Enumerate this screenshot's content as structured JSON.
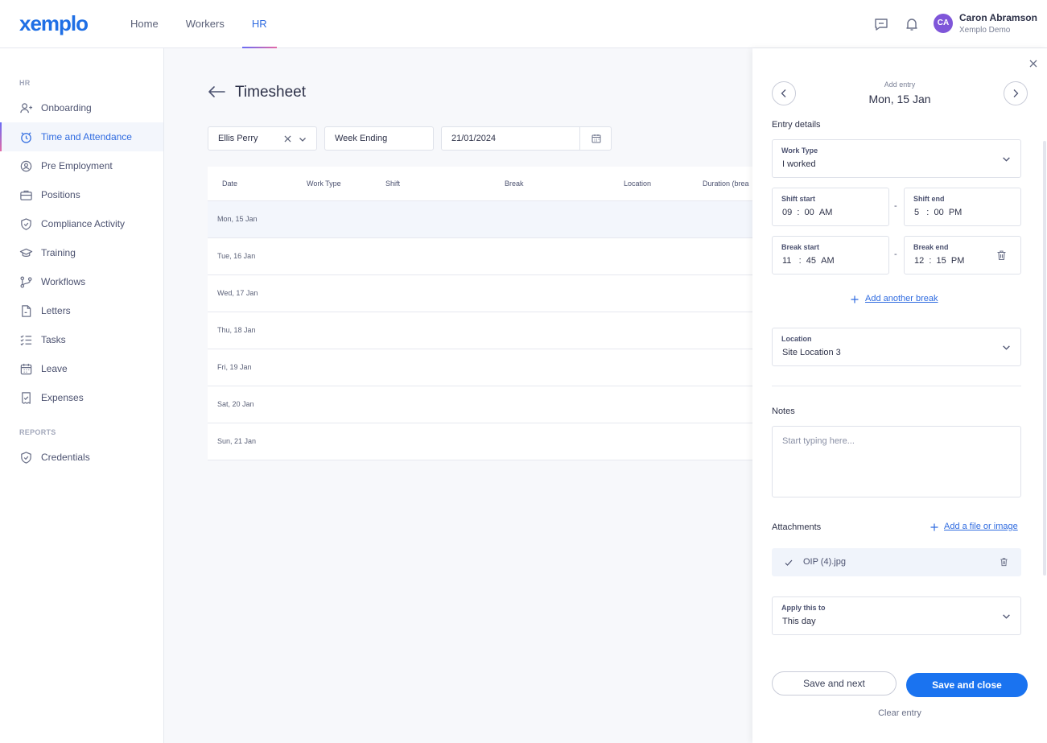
{
  "header": {
    "logo": "xemplo",
    "nav": [
      "Home",
      "Workers",
      "HR"
    ],
    "active_nav": "HR",
    "user": {
      "initials": "CA",
      "name": "Caron Abramson",
      "org": "Xemplo Demo"
    },
    "icons": [
      "chat-icon",
      "bell-icon"
    ]
  },
  "sidebar": {
    "section_hr": "HR",
    "items": [
      {
        "label": "Onboarding",
        "icon": "user-plus-icon"
      },
      {
        "label": "Time and Attendance",
        "icon": "clock-icon"
      },
      {
        "label": "Pre Employment",
        "icon": "user-check-icon"
      },
      {
        "label": "Positions",
        "icon": "briefcase-icon"
      },
      {
        "label": "Compliance Activity",
        "icon": "shield-check-icon"
      },
      {
        "label": "Training",
        "icon": "graduation-cap-icon"
      },
      {
        "label": "Workflows",
        "icon": "workflow-icon"
      },
      {
        "label": "Letters",
        "icon": "document-icon"
      },
      {
        "label": "Tasks",
        "icon": "checklist-icon"
      },
      {
        "label": "Leave",
        "icon": "calendar-icon"
      },
      {
        "label": "Expenses",
        "icon": "receipt-icon"
      }
    ],
    "section_reports": "REPORTS",
    "report_items": [
      {
        "label": "Credentials",
        "icon": "badge-check-icon"
      }
    ]
  },
  "main": {
    "title": "Timesheet",
    "filters": {
      "worker": "Ellis Perry",
      "period_type": "Week Ending",
      "date": "21/01/2024"
    },
    "columns": [
      "Date",
      "Work Type",
      "Shift",
      "Break",
      "Location",
      "Duration (brea"
    ],
    "rows": [
      "Mon, 15 Jan",
      "Tue, 16 Jan",
      "Wed, 17 Jan",
      "Thu, 18 Jan",
      "Fri, 19 Jan",
      "Sat, 20 Jan",
      "Sun, 21 Jan"
    ]
  },
  "drawer": {
    "subtitle": "Add entry",
    "date": "Mon, 15 Jan",
    "entry_details_label": "Entry details",
    "work_type": {
      "label": "Work Type",
      "value": "I worked"
    },
    "shift_start": {
      "label": "Shift start",
      "hh": "09",
      "mm": "00",
      "ampm": "AM"
    },
    "shift_end": {
      "label": "Shift end",
      "hh": "5",
      "mm": "00",
      "ampm": "PM"
    },
    "break_start": {
      "label": "Break start",
      "hh": "11",
      "mm": "45",
      "ampm": "AM"
    },
    "break_end": {
      "label": "Break end",
      "hh": "12",
      "mm": "15",
      "ampm": "PM"
    },
    "add_break": "Add another break",
    "location": {
      "label": "Location",
      "value": "Site Location 3"
    },
    "notes_label": "Notes",
    "notes_placeholder": "Start typing here...",
    "attachments_label": "Attachments",
    "add_file": "Add a file or image",
    "attachment_name": "OIP (4).jpg",
    "apply": {
      "label": "Apply this to",
      "value": "This day"
    },
    "save_next": "Save and next",
    "save_close": "Save and close",
    "clear": "Clear entry"
  }
}
